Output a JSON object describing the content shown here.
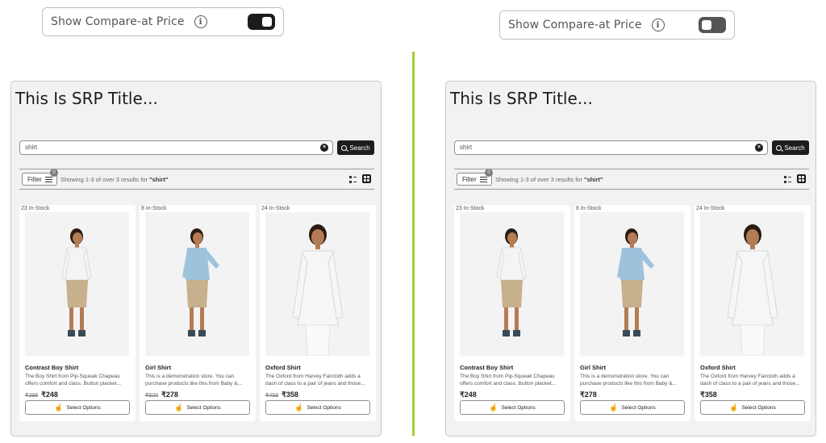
{
  "toggles": [
    {
      "label": "Show Compare-at Price",
      "state": "on"
    },
    {
      "label": "Show Compare-at Price",
      "state": "off"
    }
  ],
  "icons": {
    "info": "i",
    "clear": "×",
    "hand": "☝"
  },
  "colors": {
    "divider": "#a7d129",
    "primary_dark": "#1d1d1d",
    "panel_bg": "#f2f2f2"
  },
  "panels": [
    {
      "title": "This Is SRP Title...",
      "search_value": "shirt",
      "search_button": "Search",
      "filter_label": "Filter",
      "filter_count": "0",
      "results_prefix": "Showing 1-3 of over 3 results for",
      "results_query": "\"shirt\"",
      "products": [
        {
          "stock": "23 In-Stock",
          "name": "Contrast Boy Shirt",
          "desc": "The Boy Shirt from Pip-Squeak Chapeau offers comfort and class. Button placket...",
          "compare": "₹399",
          "price": "₹248",
          "button": "Select Options"
        },
        {
          "stock": "8 In-Stock",
          "name": "Girl Shirt",
          "desc": "This is a demonstration store. You can purchase products like this from Baby &...",
          "compare": "₹500",
          "price": "₹278",
          "button": "Select Options"
        },
        {
          "stock": "24 In-Stock",
          "name": "Oxford Shirt",
          "desc": "The Oxford from Harvey Faircloth adds a dash of class to a pair of jeans and those...",
          "compare": "₹459",
          "price": "₹358",
          "button": "Select Options"
        }
      ]
    },
    {
      "title": "This Is SRP Title...",
      "search_value": "shirt",
      "search_button": "Search",
      "filter_label": "Filter",
      "filter_count": "0",
      "results_prefix": "Showing 1-3 of over 3 results for",
      "results_query": "\"shirt\"",
      "products": [
        {
          "stock": "23 In-Stock",
          "name": "Contrast Boy Shirt",
          "desc": "The Boy Shirt from Pip-Squeak Chapeau offers comfort and class. Button placket...",
          "compare": "",
          "price": "₹248",
          "button": "Select Options"
        },
        {
          "stock": "8 In-Stock",
          "name": "Girl Shirt",
          "desc": "This is a demonstration store. You can purchase products like this from Baby &...",
          "compare": "",
          "price": "₹278",
          "button": "Select Options"
        },
        {
          "stock": "24 In-Stock",
          "name": "Oxford Shirt",
          "desc": "The Oxford from Harvey Faircloth adds a dash of class to a pair of jeans and those...",
          "compare": "",
          "price": "₹358",
          "button": "Select Options"
        }
      ]
    }
  ]
}
